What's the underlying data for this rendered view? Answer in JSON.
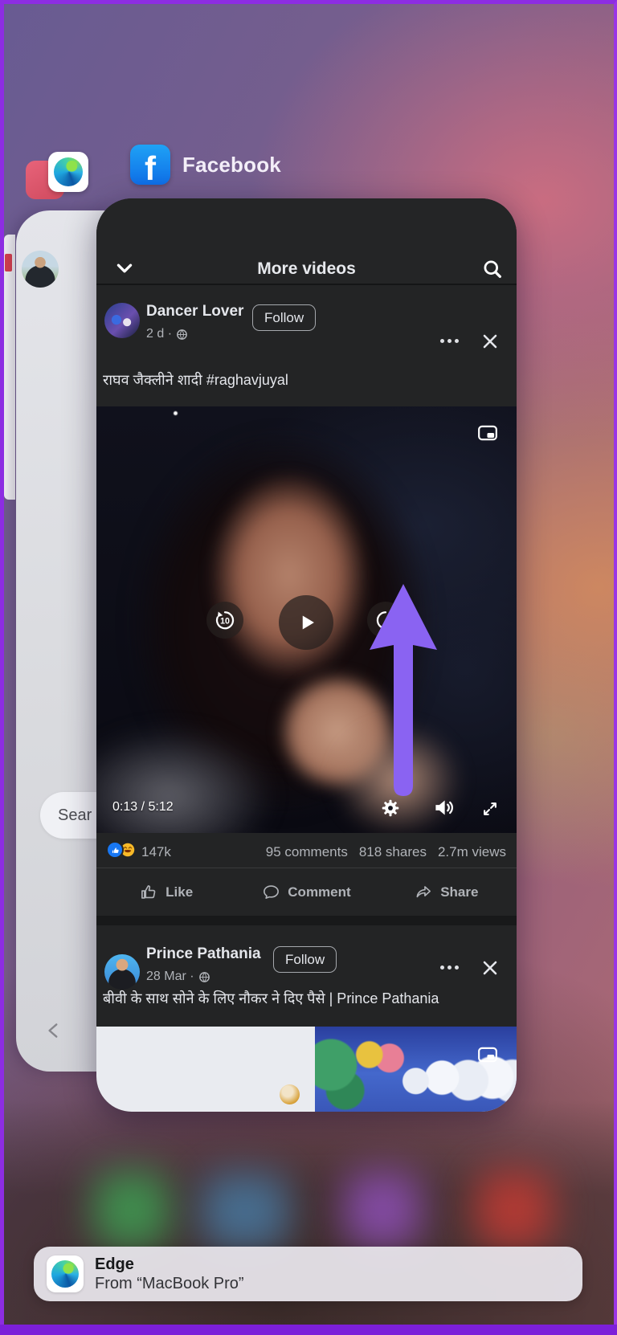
{
  "top_bar": {
    "facebook_label": "Facebook"
  },
  "edge_card": {
    "search_text": "Sear"
  },
  "facebook_card": {
    "title": "More videos",
    "posts": [
      {
        "author": "Dancer Lover",
        "follow": "Follow",
        "meta": "2 d ·",
        "caption": "राघव जैक्लीने शादी #raghavjuyal",
        "video": {
          "time": "0:13  /  5:12",
          "rewind_label": "10"
        },
        "engagement": {
          "reactions": "147k",
          "comments": "95 comments",
          "shares": "818 shares",
          "views": "2.7m views"
        },
        "actions": {
          "like": "Like",
          "comment": "Comment",
          "share": "Share"
        }
      },
      {
        "author": "Prince Pathania",
        "follow": "Follow",
        "meta": "28 Mar ·",
        "caption": "बीवी के साथ सोने के लिए नौकर ने दिए पैसे | Prince Pathania"
      }
    ]
  },
  "handoff_banner": {
    "title": "Edge",
    "subtitle": "From “MacBook Pro”"
  },
  "colors": {
    "arrow": "#8a63f2",
    "facebook_blue": "#1877f2",
    "card_bg": "#242526",
    "text_primary": "#e4e6eb",
    "text_secondary": "#b0b3b8",
    "frame_violet": "#8d2de2"
  }
}
